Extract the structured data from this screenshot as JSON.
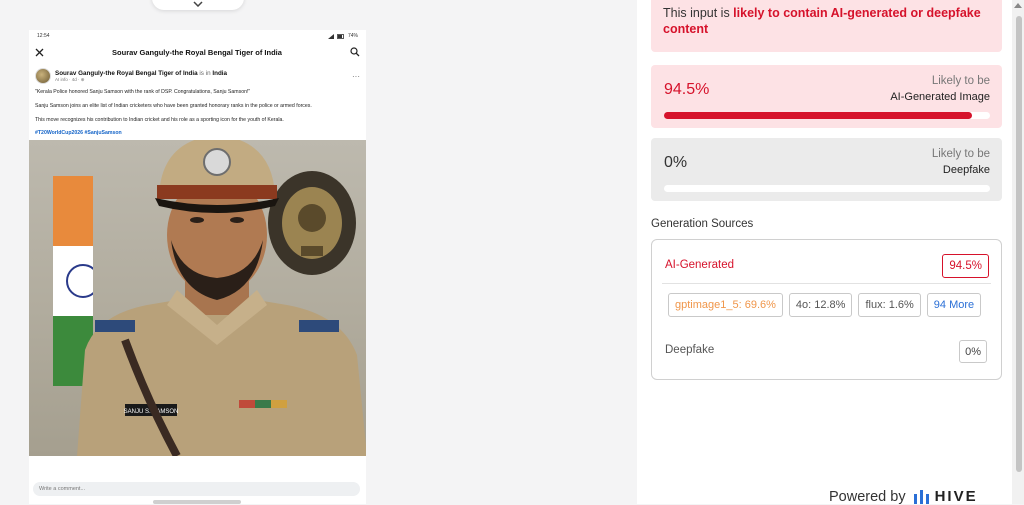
{
  "post": {
    "status_time": "12:54",
    "status_battery": "74%",
    "page_title": "Sourav Ganguly-the Royal Bengal Tiger of India",
    "author": "Sourav Ganguly-the Royal Bengal Tiger of India",
    "is_in": "is in",
    "location": "India",
    "sub": "AI info · 4d · ⊕",
    "paragraphs": [
      "\"Kerala Police honored Sanju Samson with the rank of DSP. Congratulations, Sanju Samson!\"",
      "Sanju Samson joins an elite list of Indian cricketers who have been granted honorary ranks in the police or armed forces.",
      "This move recognizes his contribution to Indian cricket and his role as a sporting icon for the youth of Kerala."
    ],
    "hashtags": "#T20WorldCup2026 #SanjuSamson",
    "name_tag": "SANJU S. SAMSON",
    "comment_placeholder": "Write a comment..."
  },
  "result": {
    "verdict_prefix": "This input is ",
    "verdict_highlight": "likely to contain AI-generated or deepfake content",
    "ai_card": {
      "percent": "94.5%",
      "label1": "Likely to be",
      "label2": "AI-Generated Image",
      "fill": 0.945
    },
    "df_card": {
      "percent": "0%",
      "label1": "Likely to be",
      "label2": "Deepfake",
      "fill": 0
    },
    "sources_title": "Generation Sources",
    "ai_generated_label": "AI-Generated",
    "ai_generated_value": "94.5%",
    "chips": [
      "gptimage1_5: 69.6%",
      "4o: 12.8%",
      "flux: 1.6%",
      "94 More"
    ],
    "deepfake_label": "Deepfake",
    "deepfake_value": "0%",
    "powered_by": "Powered by",
    "brand": "HIVE"
  },
  "colors": {
    "accent_red": "#d6122b",
    "chip_orange": "#f0964a",
    "link_blue": "#2a6fd6"
  }
}
